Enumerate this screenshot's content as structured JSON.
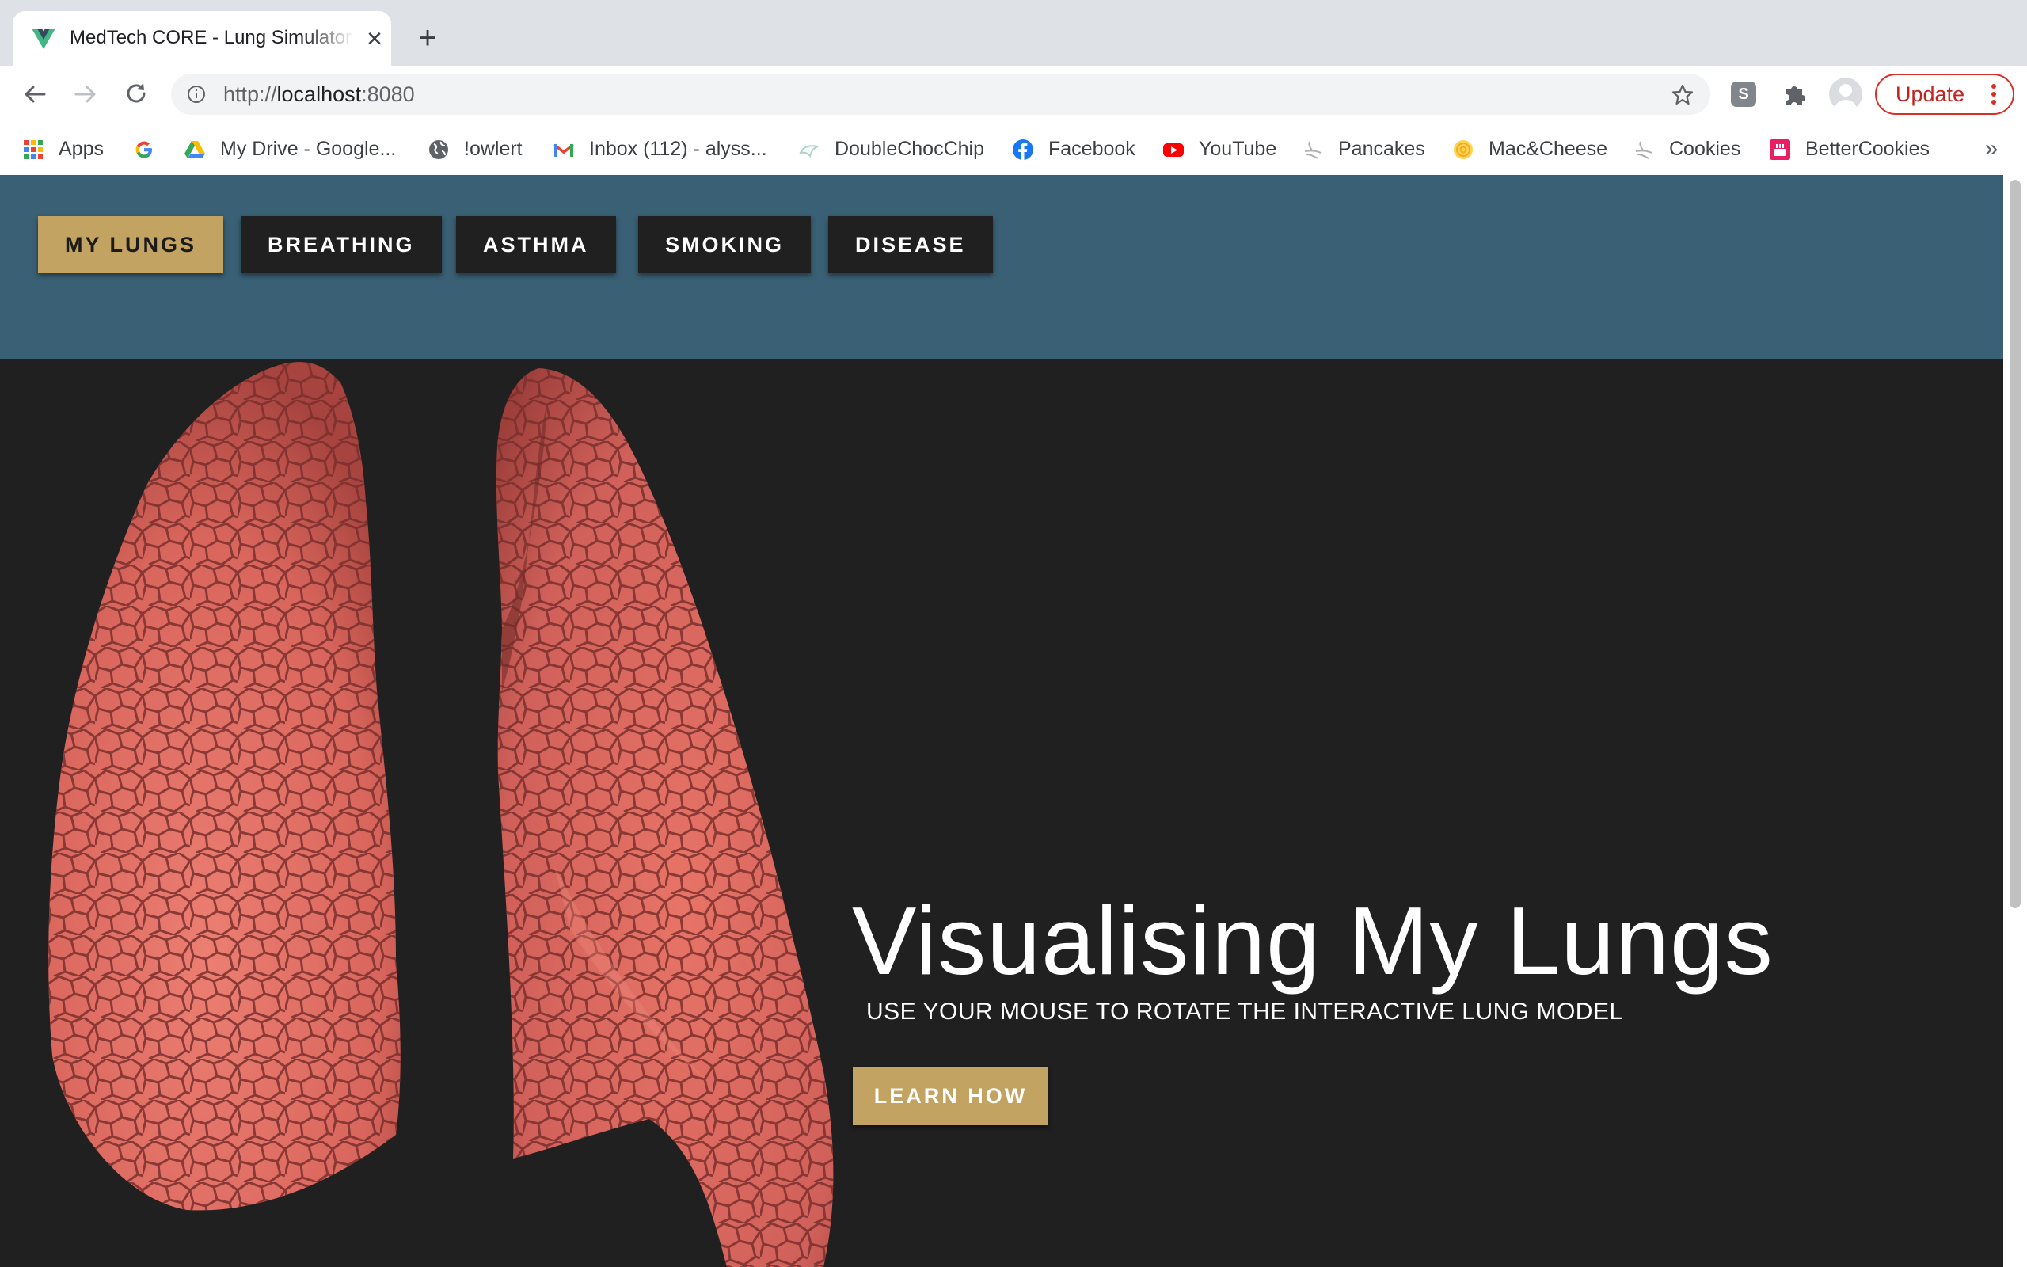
{
  "browser": {
    "tab_title": "MedTech CORE - Lung Simulator",
    "close_symbol": "✕",
    "new_tab_symbol": "+",
    "url_scheme": "http://",
    "url_host": "localhost",
    "url_port": ":8080",
    "extension_letter": "S",
    "update_label": "Update",
    "bookmarks": [
      {
        "label": "Apps",
        "icon": "apps-grid-icon"
      },
      {
        "label": "",
        "icon": "google-icon"
      },
      {
        "label": "My Drive - Google...",
        "icon": "google-drive-icon"
      },
      {
        "label": "!owlert",
        "icon": "globe-icon"
      },
      {
        "label": "Inbox (112) - alyss...",
        "icon": "gmail-icon"
      },
      {
        "label": "DoubleChocChip",
        "icon": "cookie-site-icon"
      },
      {
        "label": "Facebook",
        "icon": "facebook-icon"
      },
      {
        "label": "YouTube",
        "icon": "youtube-icon"
      },
      {
        "label": "Pancakes",
        "icon": "recipe-icon"
      },
      {
        "label": "Mac&Cheese",
        "icon": "mac-cheese-icon"
      },
      {
        "label": "Cookies",
        "icon": "recipe-icon"
      },
      {
        "label": "BetterCookies",
        "icon": "cake-icon"
      }
    ],
    "bookmarks_overflow": "»",
    "colors": {
      "tabstrip": "#dee1e6",
      "omnibox": "#f1f3f4",
      "update_red": "#c5221f"
    }
  },
  "page": {
    "nav": [
      {
        "label": "MY LUNGS",
        "active": true
      },
      {
        "label": "BREATHING",
        "active": false
      },
      {
        "label": "ASTHMA",
        "active": false
      },
      {
        "label": "SMOKING",
        "active": false
      },
      {
        "label": "DISEASE",
        "active": false
      }
    ],
    "hero_title": "Visualising My Lungs",
    "hero_subtitle": "USE YOUR MOUSE TO ROTATE THE INTERACTIVE LUNG MODEL",
    "cta_label": "LEARN HOW",
    "colors": {
      "header": "#3a6075",
      "accent_gold": "#c3a361",
      "background": "#202020",
      "lung": "#d9685f"
    }
  }
}
